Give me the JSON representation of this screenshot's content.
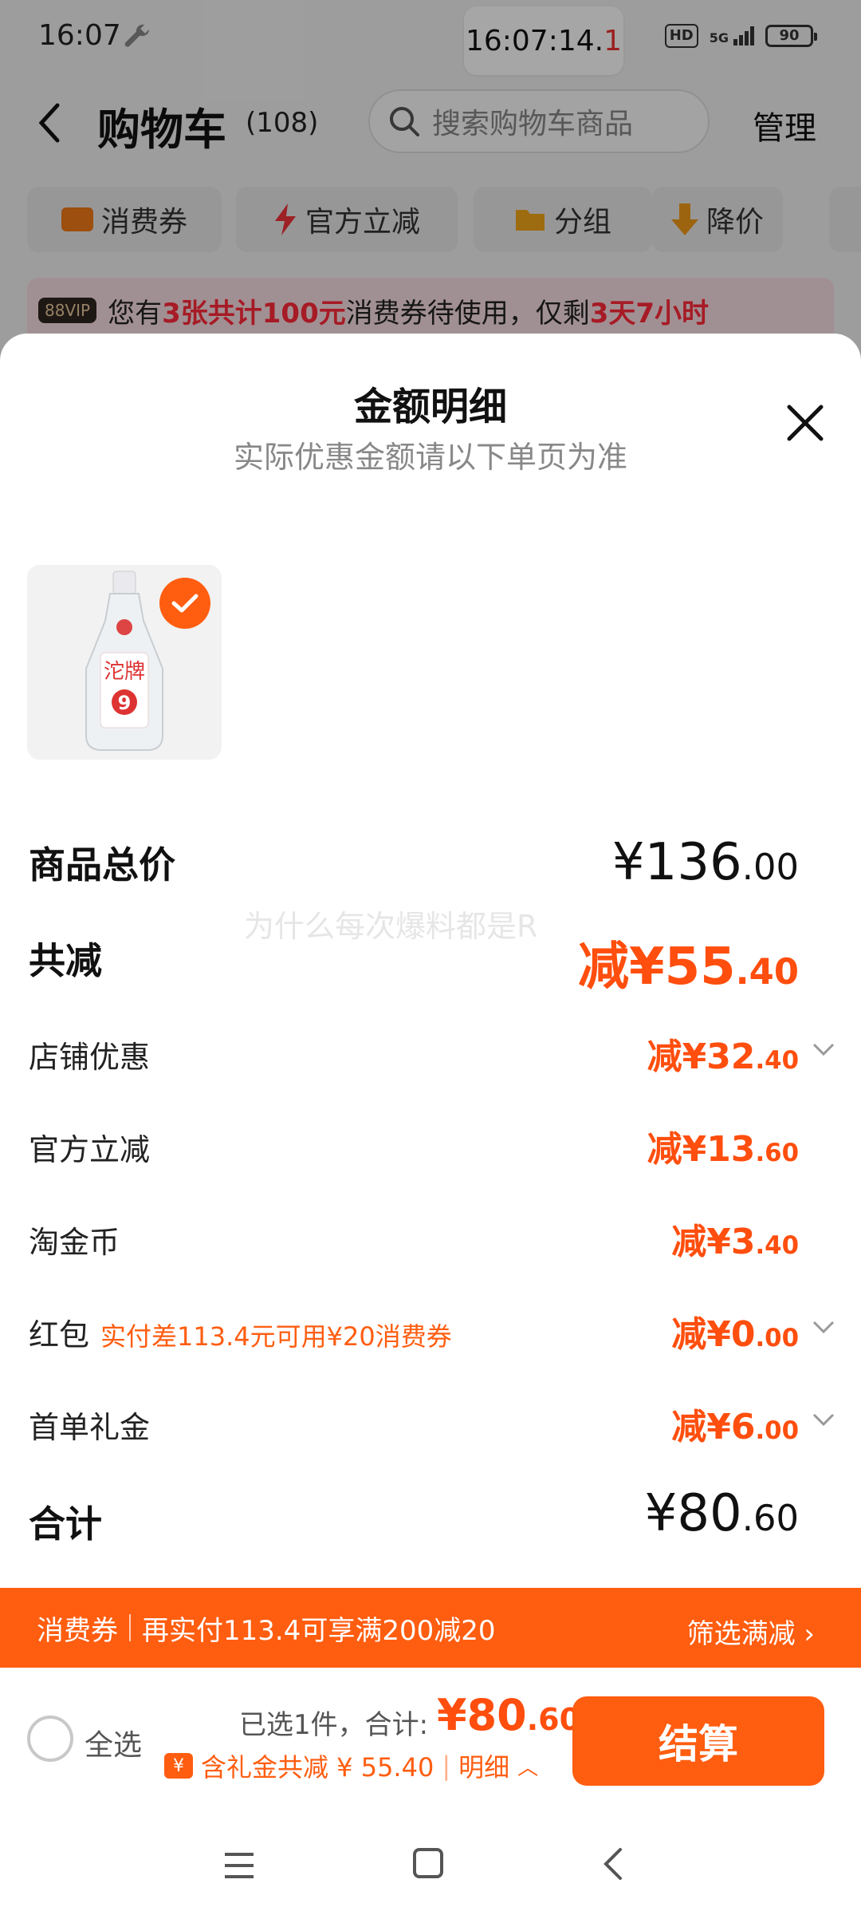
{
  "status_bar": {
    "time": "16:07",
    "clock_main": "16:07:14.",
    "clock_red": "1",
    "hd": "HD",
    "network": "5G",
    "battery": "90"
  },
  "header": {
    "title": "购物车",
    "count": "(108)",
    "search_placeholder": "搜索购物车商品",
    "manage": "管理"
  },
  "chips": [
    {
      "label": "消费券"
    },
    {
      "label": "官方立减"
    },
    {
      "label": "分组"
    },
    {
      "label": "降价"
    }
  ],
  "banner": {
    "badge": "88VIP",
    "text1": "您有",
    "highlight1": "3张共计100元",
    "text2": "消费券待使用，仅剩",
    "highlight2": "3天7小时"
  },
  "sheet": {
    "title": "金额明细",
    "subtitle": "实际优惠金额请以下单页为准",
    "watermark": "为什么每次爆料都是R",
    "rows": [
      {
        "label": "商品总价",
        "value_main": "¥136",
        "value_dec": ".00"
      },
      {
        "label": "共减",
        "value_main": "减¥55",
        "value_dec": ".40"
      },
      {
        "label": "店铺优惠",
        "value_main": "减¥32",
        "value_dec": ".40"
      },
      {
        "label": "官方立减",
        "value_main": "减¥13",
        "value_dec": ".60"
      },
      {
        "label": "淘金币",
        "value_main": "减¥3",
        "value_dec": ".40"
      },
      {
        "label": "红包",
        "note": "实付差113.4元可用¥20消费券",
        "value_main": "减¥0",
        "value_dec": ".00"
      },
      {
        "label": "首单礼金",
        "value_main": "减¥6",
        "value_dec": ".00"
      },
      {
        "label": "合计",
        "value_main": "¥80",
        "value_dec": ".60"
      }
    ]
  },
  "coupon_bar": {
    "label": "消费券",
    "text": "再实付113.4可享满200减20",
    "link": "筛选满减"
  },
  "bottom_bar": {
    "select_all": "全选",
    "selected": "已选1件，合计:",
    "total_main": "¥80",
    "total_dec": ".60",
    "gift_icon": "¥",
    "gift_text": "含礼金共减 ¥ 55.40",
    "detail": "明细",
    "checkout": "结算"
  }
}
